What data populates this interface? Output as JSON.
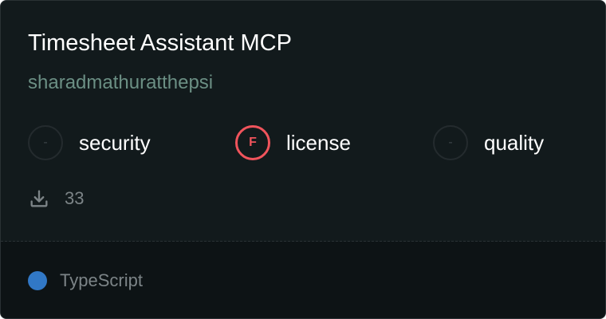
{
  "card": {
    "title": "Timesheet Assistant MCP",
    "owner": "sharadmathuratthepsi",
    "metrics": [
      {
        "badge": "-",
        "label": "security",
        "status": "none"
      },
      {
        "badge": "F",
        "label": "license",
        "status": "fail"
      },
      {
        "badge": "-",
        "label": "quality",
        "status": "none"
      }
    ],
    "downloads": {
      "icon": "download-icon",
      "count": "33"
    },
    "language": {
      "name": "TypeScript",
      "color": "#3178c6"
    }
  }
}
